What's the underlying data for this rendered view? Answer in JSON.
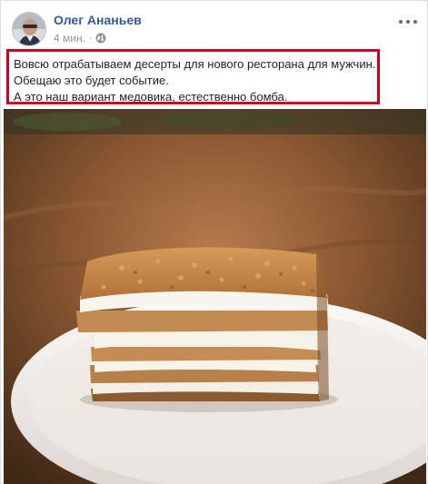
{
  "post": {
    "author": "Олег Ананьев",
    "time": "4 мин.",
    "separator": "·",
    "privacy_icon": "globe-icon",
    "more_icon": "more-options-icon",
    "text_lines": [
      "Вовсю отрабатываем десерты для нового ресторана для мужчин.",
      "Обещаю это будет событие.",
      "А это наш вариант медовика, естественно бомба."
    ],
    "highlight_color": "#d0021b",
    "link_color": "#365899"
  },
  "photo": {
    "subject": "honey-cake-photo",
    "colors": {
      "background": "#6b4528",
      "plate": "#f4f1ee",
      "crumb": "#c98a4b",
      "cream": "#f7f3ea",
      "layer": "#b8814b"
    }
  }
}
